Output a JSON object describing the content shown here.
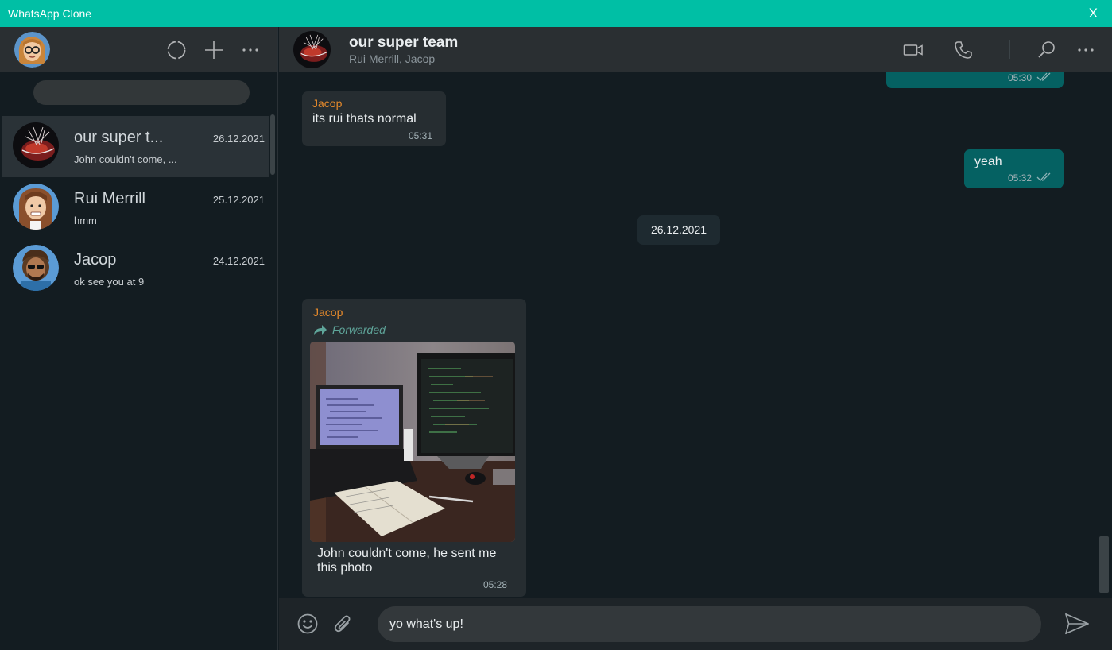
{
  "window": {
    "title": "WhatsApp Clone",
    "close_label": "X"
  },
  "sidebar": {
    "icons": [
      "status-icon",
      "new-chat-icon",
      "menu-icon"
    ],
    "search": {
      "value": "",
      "placeholder": ""
    },
    "chats": [
      {
        "name": "our super t...",
        "date": "26.12.2021",
        "preview": "John couldn't come, ...",
        "active": true
      },
      {
        "name": "Rui Merrill",
        "date": "25.12.2021",
        "preview": "hmm",
        "active": false
      },
      {
        "name": "Jacop",
        "date": "24.12.2021",
        "preview": "ok see you at 9",
        "active": false
      }
    ]
  },
  "chat": {
    "title": "our super team",
    "members": "Rui Merrill, Jacop",
    "header_icons": [
      "video-call-icon",
      "voice-call-icon",
      "search-icon",
      "menu-icon"
    ],
    "messages": [
      {
        "direction": "out",
        "time": "05:30"
      },
      {
        "direction": "in",
        "sender": "Jacop",
        "text": "its rui thats normal",
        "time": "05:31"
      },
      {
        "direction": "out",
        "text": "yeah",
        "time": "05:32"
      },
      {
        "type": "date",
        "text": "26.12.2021"
      },
      {
        "direction": "in",
        "sender": "Jacop",
        "forwarded_label": "Forwarded",
        "text": "John couldn't come, he sent me this photo",
        "time": "05:28"
      }
    ],
    "composer": {
      "value": "yo what's up!",
      "placeholder": ""
    },
    "colors": {
      "accent": "#00bfa5",
      "outgoing_bubble": "#056162",
      "incoming_bubble": "#262d31",
      "sender_name": "#e78a2b"
    }
  }
}
